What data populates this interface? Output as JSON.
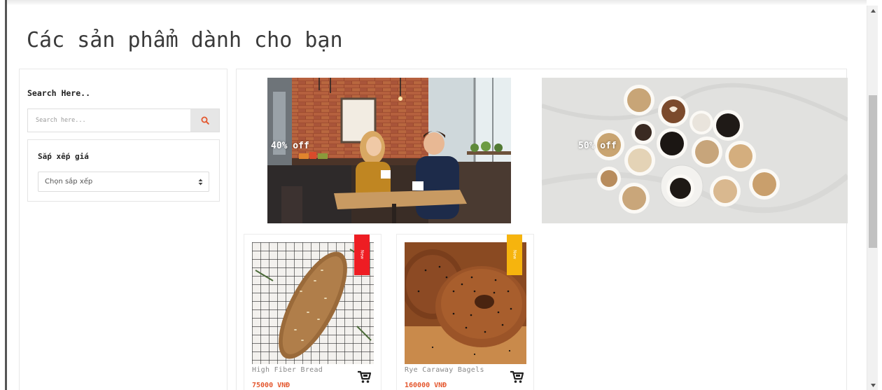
{
  "page": {
    "title": "Các sản phẩm dành cho bạn"
  },
  "sidebar": {
    "search_heading": "Search Here..",
    "search_placeholder": "Search here...",
    "sort_heading": "Sắp xếp giá",
    "sort_selected": "Chọn sắp xếp"
  },
  "banners": [
    {
      "label": "40% off"
    },
    {
      "label": "50% off"
    }
  ],
  "products": [
    {
      "name": "High Fiber Bread",
      "price": "75000 VNĐ",
      "badge": "New",
      "badge_color": "#ee1d23"
    },
    {
      "name": "Rye Caraway Bagels",
      "price": "160000 VNĐ",
      "badge": "New",
      "badge_color": "#f6b40e"
    }
  ],
  "colors": {
    "accent": "#e4572e",
    "search_icon": "#e4572e"
  },
  "icons": {
    "search": "search-icon",
    "cart": "cart-icon",
    "sort": "sort-arrows-icon"
  }
}
